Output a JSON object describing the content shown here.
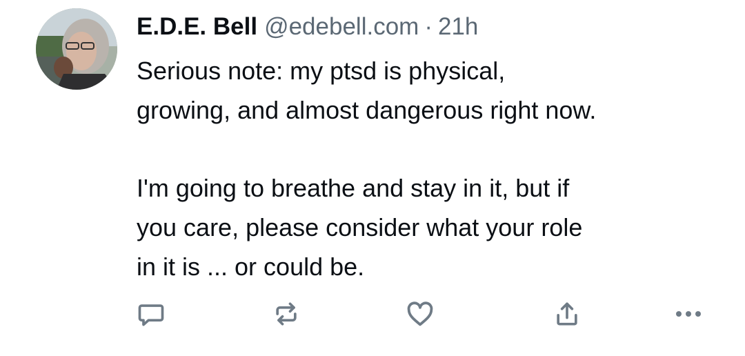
{
  "post": {
    "author": {
      "name": "E.D.E. Bell",
      "handle": "@edebell.com",
      "avatar_icon": "user-avatar-photo"
    },
    "separator": "·",
    "time": "21h",
    "paragraphs": [
      "Serious note: my ptsd is physical,\ngrowing, and almost dangerous right now.",
      "I'm going to breathe and stay in it, but if\nyou care, please consider what your role\nin it is ... or could be."
    ],
    "actions": [
      {
        "icon": "reply-icon"
      },
      {
        "icon": "repost-icon"
      },
      {
        "icon": "heart-icon"
      },
      {
        "icon": "share-icon"
      },
      {
        "icon": "more-icon"
      }
    ]
  },
  "colors": {
    "text": "#0b0f14",
    "muted": "#5b6874",
    "icon": "#6f7b86",
    "background": "#ffffff"
  }
}
